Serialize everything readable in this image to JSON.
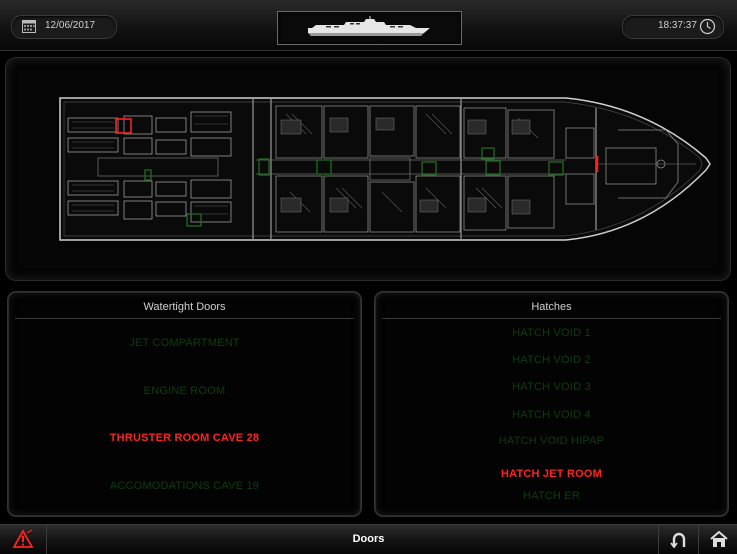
{
  "header": {
    "date": "12/06/2017",
    "time": "18:37:37",
    "calendar_icon": "calendar-icon",
    "clock_icon": "clock-icon",
    "vessel_icon": "yacht-icon"
  },
  "watertight_doors": {
    "title": "Watertight Doors",
    "items": [
      {
        "label": "JET COMPARTMENT",
        "status": "closed"
      },
      {
        "label": "ENGINE ROOM",
        "status": "closed"
      },
      {
        "label": "THRUSTER ROOM CAVE 28",
        "status": "alarm"
      },
      {
        "label": "ACCOMODATIONS CAVE 19",
        "status": "closed"
      }
    ]
  },
  "hatches": {
    "title": "Hatches",
    "items": [
      {
        "label": "HATCH VOID 1",
        "status": "closed"
      },
      {
        "label": "HATCH VOID 2",
        "status": "closed"
      },
      {
        "label": "HATCH VOID 3",
        "status": "closed"
      },
      {
        "label": "HATCH VOID 4",
        "status": "closed"
      },
      {
        "label": "HATCH VOID HIPAP",
        "status": "closed"
      },
      {
        "label": "HATCH JET ROOM",
        "status": "alarm"
      },
      {
        "label": "HATCH ER",
        "status": "closed"
      }
    ]
  },
  "footer": {
    "title": "Doors",
    "alarm_icon": "warning-icon",
    "back_icon": "undo-icon",
    "home_icon": "home-icon"
  },
  "colors": {
    "closed": "#0f3d0f",
    "alarm": "#ff2222",
    "text": "#cfcfcf"
  }
}
